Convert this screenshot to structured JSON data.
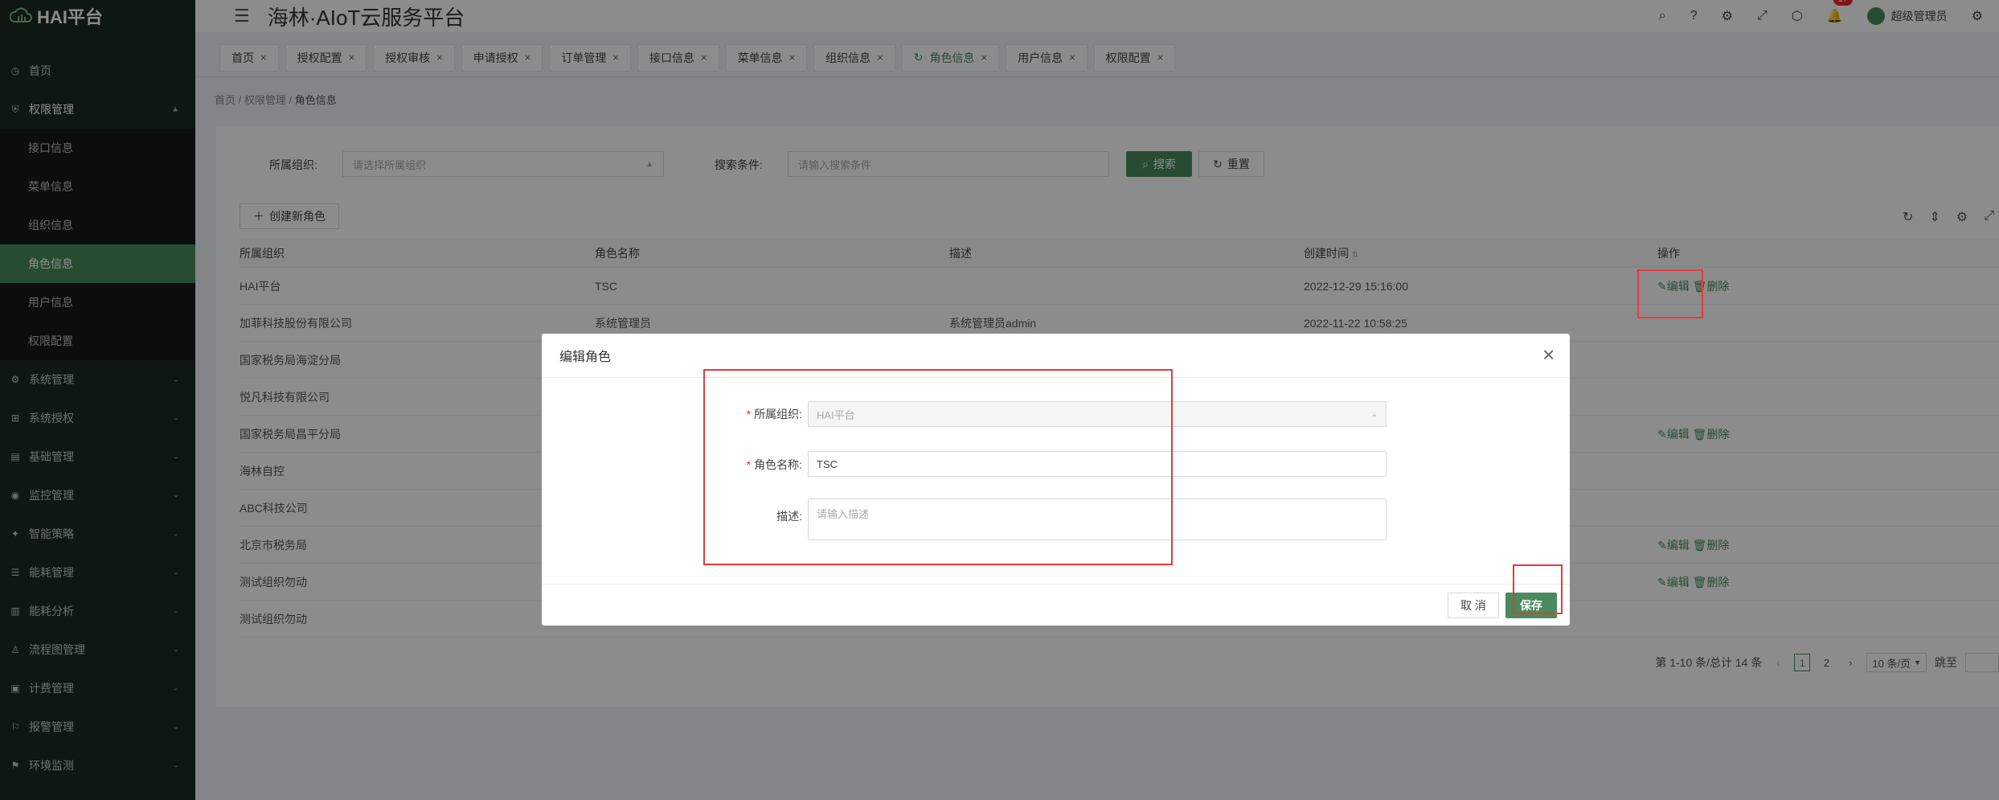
{
  "app": {
    "name": "HAI平台",
    "page_title": "海林·AIoT云服务平台"
  },
  "header": {
    "notification_count": "17",
    "user_name": "超级管理员"
  },
  "sidebar": {
    "home": "首页",
    "permission": "权限管理",
    "sub": [
      "接口信息",
      "菜单信息",
      "组织信息",
      "角色信息",
      "用户信息",
      "权限配置"
    ],
    "active_sub": "角色信息",
    "groups": [
      "系统管理",
      "系统授权",
      "基础管理",
      "监控管理",
      "智能策略",
      "能耗管理",
      "能耗分析",
      "流程图管理",
      "计费管理",
      "报警管理",
      "环境监测"
    ]
  },
  "tabs": [
    {
      "label": "首页"
    },
    {
      "label": "授权配置"
    },
    {
      "label": "授权审核"
    },
    {
      "label": "申请授权"
    },
    {
      "label": "订单管理"
    },
    {
      "label": "接口信息"
    },
    {
      "label": "菜单信息"
    },
    {
      "label": "组织信息"
    },
    {
      "label": "角色信息",
      "active": true
    },
    {
      "label": "用户信息"
    },
    {
      "label": "权限配置"
    }
  ],
  "breadcrumb": [
    "首页",
    "权限管理",
    "角色信息"
  ],
  "search": {
    "org_label": "所属组织:",
    "org_placeholder": "请选择所属组织",
    "cond_label": "搜索条件:",
    "cond_placeholder": "请输入搜索条件",
    "search_btn": "搜索",
    "reset_btn": "重置"
  },
  "create_btn": "创建新角色",
  "table": {
    "headers": [
      "所属组织",
      "角色名称",
      "描述",
      "创建时间",
      "操作"
    ],
    "rows": [
      {
        "org": "HAI平台",
        "role": "TSC",
        "desc": "",
        "time": "2022-12-29 15:16:00",
        "actions": true
      },
      {
        "org": "加菲科技股份有限公司",
        "role": "系统管理员",
        "desc": "系统管理员admin",
        "time": "2022-11-22 10:58:25",
        "actions": false
      },
      {
        "org": "国家税务局海淀分局",
        "role": "",
        "desc": "",
        "time": "",
        "actions": false
      },
      {
        "org": "悦凡科技有限公司",
        "role": "",
        "desc": "",
        "time": "",
        "actions": false
      },
      {
        "org": "国家税务局昌平分局",
        "role": "",
        "desc": "",
        "time": "",
        "actions": true
      },
      {
        "org": "海林自控",
        "role": "",
        "desc": "",
        "time": "",
        "actions": false
      },
      {
        "org": "ABC科技公司",
        "role": "",
        "desc": "",
        "time": "",
        "actions": false
      },
      {
        "org": "北京市税务局",
        "role": "",
        "desc": "",
        "time": "",
        "actions": true
      },
      {
        "org": "测试组织勿动",
        "role": "",
        "desc": "",
        "time": "",
        "actions": true
      },
      {
        "org": "测试组织勿动",
        "role": "",
        "desc": "",
        "time": "",
        "actions": false
      }
    ],
    "edit_label": "编辑",
    "delete_label": "删除"
  },
  "pagination": {
    "total": "第 1-10 条/总计 14 条",
    "pages": [
      "1",
      "2"
    ],
    "page_size": "10 条/页",
    "jump_label": "跳至"
  },
  "modal": {
    "title": "编辑角色",
    "org_label": "所属组织:",
    "org_value": "HAI平台",
    "role_label": "角色名称:",
    "role_value": "TSC",
    "desc_label": "描述:",
    "desc_placeholder": "请输入描述",
    "cancel": "取 消",
    "save": "保存"
  }
}
